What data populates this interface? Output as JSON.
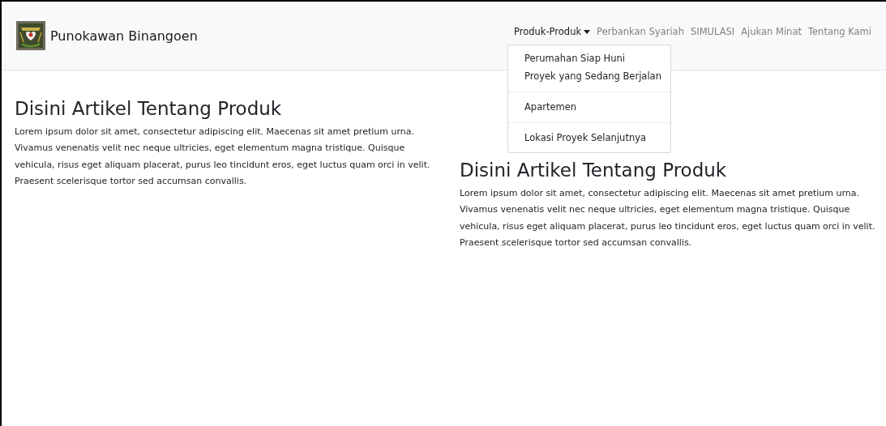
{
  "navbar": {
    "brand": "Punokawan Binangoen",
    "links": [
      {
        "label": "Produk-Produk",
        "kind": "dropdown",
        "selected": true,
        "expanded": true,
        "menu_groups": [
          [
            "Perumahan Siap Huni",
            "Proyek yang Sedang Berjalan"
          ],
          [
            "Apartemen"
          ],
          [
            "Lokasi Proyek Selanjutnya"
          ]
        ]
      },
      {
        "label": "Perbankan Syariah",
        "kind": "link",
        "selected": false
      },
      {
        "label": "SIMULASI",
        "kind": "link",
        "selected": false
      },
      {
        "label": "Ajukan Minat",
        "kind": "link",
        "selected": false
      },
      {
        "label": "Tentang Kami",
        "kind": "link",
        "selected": false
      }
    ]
  },
  "articles": [
    {
      "title": "Disini Artikel Tentang Produk",
      "body": "Lorem ipsum dolor sit amet, consectetur adipiscing elit. Maecenas sit amet pretium urna. Vivamus venenatis velit nec neque ultricies, eget elementum magna tristique. Quisque vehicula, risus eget aliquam placerat, purus leo tincidunt eros, eget luctus quam orci in velit. Praesent scelerisque tortor sed accumsan convallis."
    },
    {
      "title": "Disini Artikel Tentang Produk",
      "body": "Lorem ipsum dolor sit amet, consectetur adipiscing elit. Maecenas sit amet pretium urna. Vivamus venenatis velit nec neque ultricies, eget elementum magna tristique. Quisque vehicula, risus eget aliquam placerat, purus leo tincidunt eros, eget luctus quam orci in velit. Praesent scelerisque tortor sed accumsan convallis."
    }
  ]
}
